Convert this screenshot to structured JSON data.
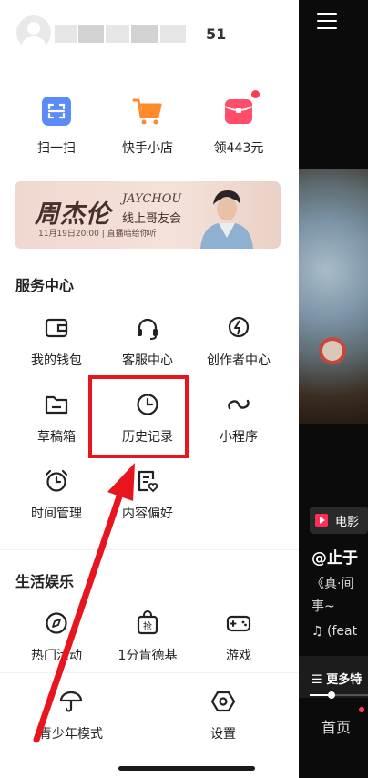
{
  "profile": {
    "username_tail": "51"
  },
  "quick_actions": [
    {
      "label": "扫一扫",
      "icon": "scan-icon",
      "color": "#5b8cf5"
    },
    {
      "label": "快手小店",
      "icon": "shop-cart-icon",
      "color": "#ff8a2b"
    },
    {
      "label": "领443元",
      "icon": "red-packet-icon",
      "color": "#ff4d6a"
    }
  ],
  "banner": {
    "title": "周杰伦",
    "title_en": "JAYCHOU",
    "subtitle": "线上哥友会",
    "date_text": "11月19日20:00 | 直播暗给你听"
  },
  "service_center": {
    "title": "服务中心",
    "items": [
      {
        "label": "我的钱包",
        "icon": "wallet-icon"
      },
      {
        "label": "客服中心",
        "icon": "headset-icon"
      },
      {
        "label": "创作者中心",
        "icon": "lightning-icon"
      },
      {
        "label": "草稿箱",
        "icon": "folder-icon"
      },
      {
        "label": "历史记录",
        "icon": "clock-icon"
      },
      {
        "label": "小程序",
        "icon": "mini-program-icon"
      },
      {
        "label": "时间管理",
        "icon": "alarm-clock-icon"
      },
      {
        "label": "内容偏好",
        "icon": "content-preference-icon"
      }
    ]
  },
  "life_entertainment": {
    "title": "生活娱乐",
    "items": [
      {
        "label": "热门活动",
        "icon": "compass-icon"
      },
      {
        "label": "1分肯德基",
        "icon": "grab-bag-icon"
      },
      {
        "label": "游戏",
        "icon": "gamepad-icon"
      }
    ]
  },
  "bottom_items": [
    {
      "label": "青少年模式",
      "icon": "umbrella-icon"
    },
    {
      "label": "设置",
      "icon": "hexagon-settings-icon"
    }
  ],
  "right_panel": {
    "tag": "电影",
    "author": "@止于",
    "desc": "《真·间",
    "desc2": "事~",
    "music": "(feat",
    "more": "更多特",
    "nav_home": "首页"
  },
  "colors": {
    "highlight_box": "#e8141e",
    "arrow": "#e8141e",
    "accent_dot": "#ff3a55"
  }
}
